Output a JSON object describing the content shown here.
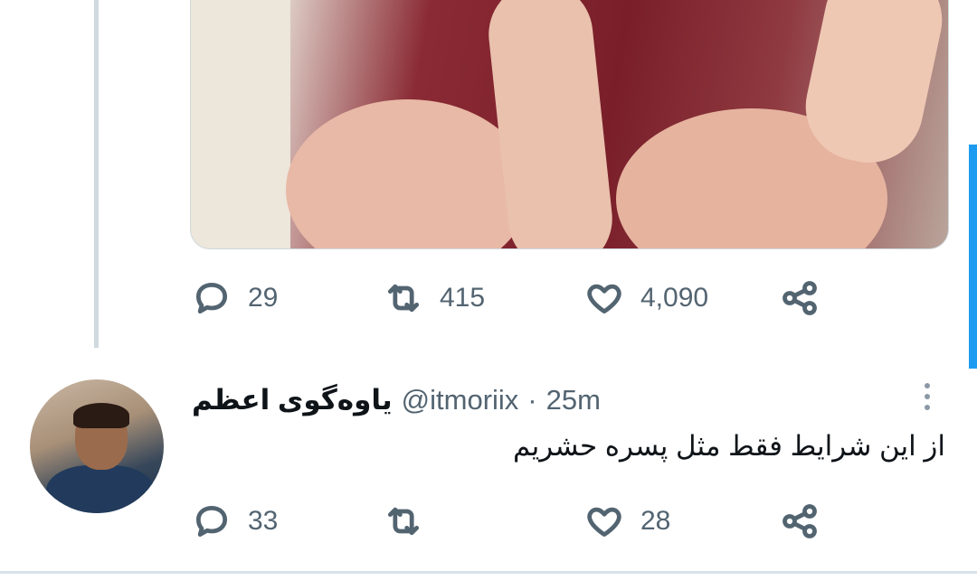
{
  "colors": {
    "muted": "#536471",
    "text": "#0f1419",
    "accent": "#1d9bf0"
  },
  "tweet1": {
    "actions": {
      "reply_count": "29",
      "retweet_count": "415",
      "like_count": "4,090"
    }
  },
  "tweet2": {
    "display_name": "یاوه‌گوی اعظم",
    "handle": "@itmoriix",
    "separator": "·",
    "time": "25m",
    "text": "از این شرایط فقط مثل پسره حشریم",
    "actions": {
      "reply_count": "33",
      "retweet_count": "",
      "like_count": "28"
    }
  },
  "icons": [
    "reply-icon",
    "retweet-icon",
    "like-icon",
    "share-icon",
    "more-icon"
  ]
}
